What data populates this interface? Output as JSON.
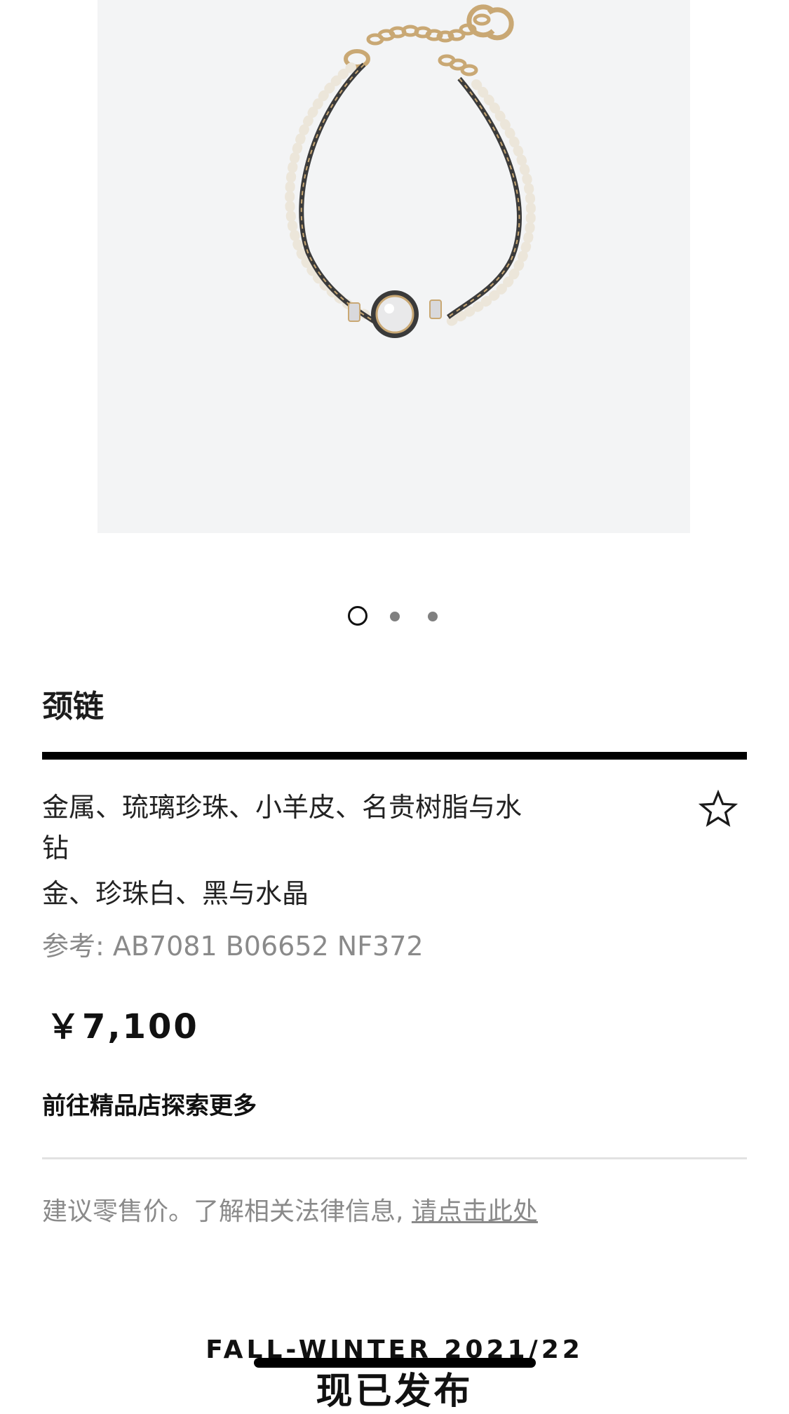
{
  "product": {
    "name": "颈链",
    "materials": "金属、琉璃珍珠、小羊皮、名贵树脂与水钻",
    "colors": "金、珍珠白、黑与水晶",
    "reference": "参考: AB7081 B06652 NF372",
    "price": "￥7,100"
  },
  "carousel": {
    "active_index": 1,
    "total": 3
  },
  "links": {
    "explore": "前往精品店探索更多"
  },
  "legal": {
    "text": "建议零售价。了解相关法律信息, ",
    "link": "请点击此处"
  },
  "banner": {
    "season": "FALL-WINTER 2021/22",
    "subtitle": "现已发布"
  },
  "icons": {
    "wishlist": "star-outline-icon"
  },
  "colors_ui": {
    "image_bg": "#f3f4f5",
    "text_primary": "#1d1d1d",
    "text_secondary": "#8a8a8a",
    "rule": "#000000",
    "divider": "#e2e2e2"
  }
}
